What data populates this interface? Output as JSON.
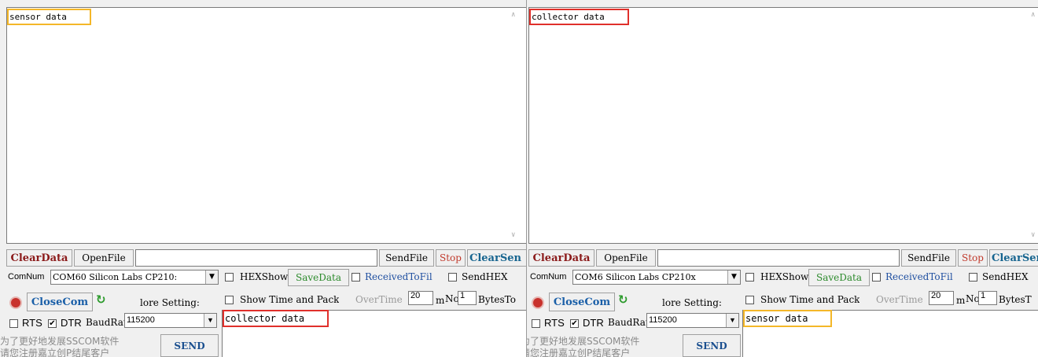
{
  "left": {
    "receive_text": "sensor data",
    "toolbar": {
      "clear_data": "ClearData",
      "open_file": "OpenFile",
      "send_file": "SendFile",
      "stop": "Stop",
      "clear_send": "ClearSen"
    },
    "com_label": "ComNum",
    "com_value": "COM60 Silicon Labs CP210:",
    "close_com": "CloseCom",
    "more_settings": "lore Setting:",
    "rts_label": "RTS",
    "dtr_label": "DTR",
    "baud_label": "BaudRat",
    "baud_value": "115200",
    "cn_line1": "为了更好地发展SSCOM软件",
    "cn_line2": "请您注册嘉立创P结尾客户",
    "send_button": "SEND",
    "hex_show": "HEXShow",
    "save_data": "SaveData",
    "received_to_file": "ReceivedToFil",
    "send_hex": "SendHEX",
    "show_time": "Show Time and Pack",
    "overtime_label": "OverTime",
    "overtime_value": "20",
    "ms_label": "ms",
    "no_label": "No",
    "no_value": "1",
    "bytes_label": "BytesTo",
    "send_text": "collector data"
  },
  "right": {
    "receive_text": "collector data",
    "toolbar": {
      "clear_data": "ClearData",
      "open_file": "OpenFile",
      "send_file": "SendFile",
      "stop": "Stop",
      "clear_send": "ClearSen"
    },
    "com_label": "ComNum",
    "com_value": "COM6 Silicon Labs CP210x",
    "close_com": "CloseCom",
    "more_settings": "lore Setting:",
    "rts_label": "RTS",
    "dtr_label": "DTR",
    "baud_label": "BaudRat",
    "baud_value": "115200",
    "cn_line1": "为了更好地发展SSCOM软件",
    "cn_line2": "请您注册嘉立创P结尾客户",
    "send_button": "SEND",
    "hex_show": "HEXShow",
    "save_data": "SaveData",
    "received_to_file": "ReceivedToFil",
    "send_hex": "SendHEX",
    "show_time": "Show Time and Pack",
    "overtime_label": "OverTime",
    "overtime_value": "20",
    "ms_label": "ms",
    "no_label": "No",
    "no_value": "1",
    "bytes_label": "BytesT",
    "send_text": "sensor data"
  },
  "icons": {
    "scroll_up": "chevron-up-icon",
    "scroll_down": "chevron-down-icon",
    "dropdown": "dropdown-arrow-icon",
    "refresh": "refresh-icon",
    "status_led": "status-led-icon"
  },
  "colors": {
    "highlight_sensor": "#f4b728",
    "highlight_collector": "#e0302b",
    "clear_data": "#8b1a1a",
    "close_com": "#1a5fa8",
    "save_data": "#2b8a2b",
    "refresh": "#2b9a2b"
  }
}
